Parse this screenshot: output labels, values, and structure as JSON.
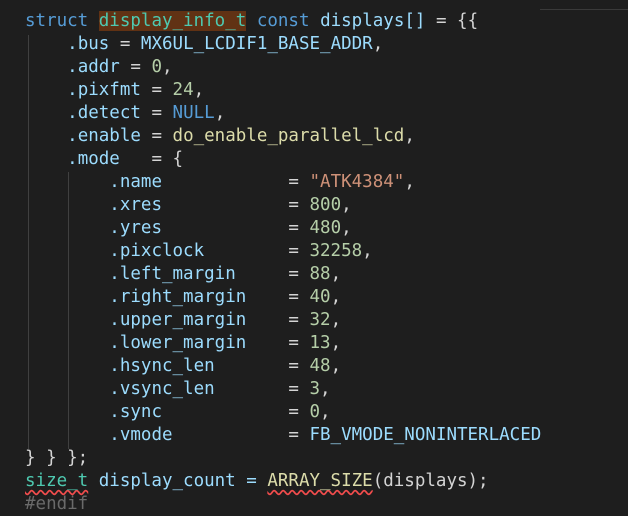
{
  "code": {
    "l1": {
      "kw1": "struct",
      "type": "display_info_t",
      "kw2": "const",
      "name": "displays[]",
      "op": " = {{"
    },
    "l2": {
      "field": ".bus",
      "eq": " = ",
      "val": "MX6UL_LCDIF1_BASE_ADDR",
      "end": ","
    },
    "l3": {
      "field": ".addr",
      "eq": " = ",
      "val": "0",
      "end": ","
    },
    "l4": {
      "field": ".pixfmt",
      "eq": " = ",
      "val": "24",
      "end": ","
    },
    "l5": {
      "field": ".detect",
      "eq": " = ",
      "val": "NULL",
      "end": ","
    },
    "l6": {
      "field": ".enable",
      "eq": " = ",
      "val": "do_enable_parallel_lcd",
      "end": ","
    },
    "l7": {
      "field": ".mode",
      "eq": "   = {"
    },
    "mode_fields": [
      {
        "field": ".name",
        "pad": "            = ",
        "val": "\"ATK4384\"",
        "end": ",",
        "kind": "str"
      },
      {
        "field": ".xres",
        "pad": "            = ",
        "val": "800",
        "end": ",",
        "kind": "num"
      },
      {
        "field": ".yres",
        "pad": "            = ",
        "val": "480",
        "end": ",",
        "kind": "num"
      },
      {
        "field": ".pixclock",
        "pad": "        = ",
        "val": "32258",
        "end": ",",
        "kind": "num"
      },
      {
        "field": ".left_margin",
        "pad": "     = ",
        "val": "88",
        "end": ",",
        "kind": "num"
      },
      {
        "field": ".right_margin",
        "pad": "    = ",
        "val": "40",
        "end": ",",
        "kind": "num"
      },
      {
        "field": ".upper_margin",
        "pad": "    = ",
        "val": "32",
        "end": ",",
        "kind": "num"
      },
      {
        "field": ".lower_margin",
        "pad": "    = ",
        "val": "13",
        "end": ",",
        "kind": "num"
      },
      {
        "field": ".hsync_len",
        "pad": "       = ",
        "val": "48",
        "end": ",",
        "kind": "num"
      },
      {
        "field": ".vsync_len",
        "pad": "       = ",
        "val": "3",
        "end": ",",
        "kind": "num"
      },
      {
        "field": ".sync",
        "pad": "            = ",
        "val": "0",
        "end": ",",
        "kind": "num"
      },
      {
        "field": ".vmode",
        "pad": "           = ",
        "val": "FB_VMODE_NONINTERLACED",
        "end": "",
        "kind": "const"
      }
    ],
    "l20": {
      "text": "} } };"
    },
    "l21": {
      "type": "size_t",
      "name": " display_count = ",
      "fn": "ARRAY_SIZE",
      "args": "(displays);"
    },
    "l22": {
      "text": "#endif"
    }
  }
}
